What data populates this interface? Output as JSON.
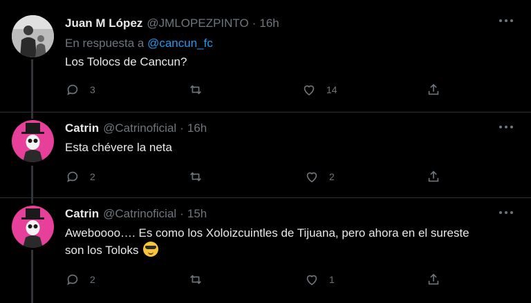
{
  "tweets": [
    {
      "name": "Juan M López",
      "handle": "@JMLOPEZPINTO",
      "dot": "·",
      "time": "16h",
      "reply_prefix": "En respuesta a",
      "reply_handle": "@cancun_fc",
      "text": "Los Tolocs de Cancun?",
      "replies": "3",
      "retweets": "",
      "likes": "14",
      "avatar_icon": "person-photo-avatar"
    },
    {
      "name": "Catrin",
      "handle": "@Catrinoficial",
      "dot": "·",
      "time": "16h",
      "text": "Esta chévere la neta",
      "replies": "2",
      "retweets": "",
      "likes": "2",
      "avatar_icon": "catrin-skull-avatar"
    },
    {
      "name": "Catrin",
      "handle": "@Catrinoficial",
      "dot": "·",
      "time": "15h",
      "text": "Aweboooo…. Es como los Xoloizcuintles de Tijuana, pero ahora en el sureste son los Toloks",
      "emoji": "sunglasses-emoji",
      "replies": "2",
      "retweets": "",
      "likes": "1",
      "avatar_icon": "catrin-skull-avatar"
    }
  ],
  "colors": {
    "background": "#000000",
    "text": "#e7e9ea",
    "muted": "#6e767d",
    "link": "#1d9bf0",
    "avatar_catrin": "#e6409a"
  }
}
